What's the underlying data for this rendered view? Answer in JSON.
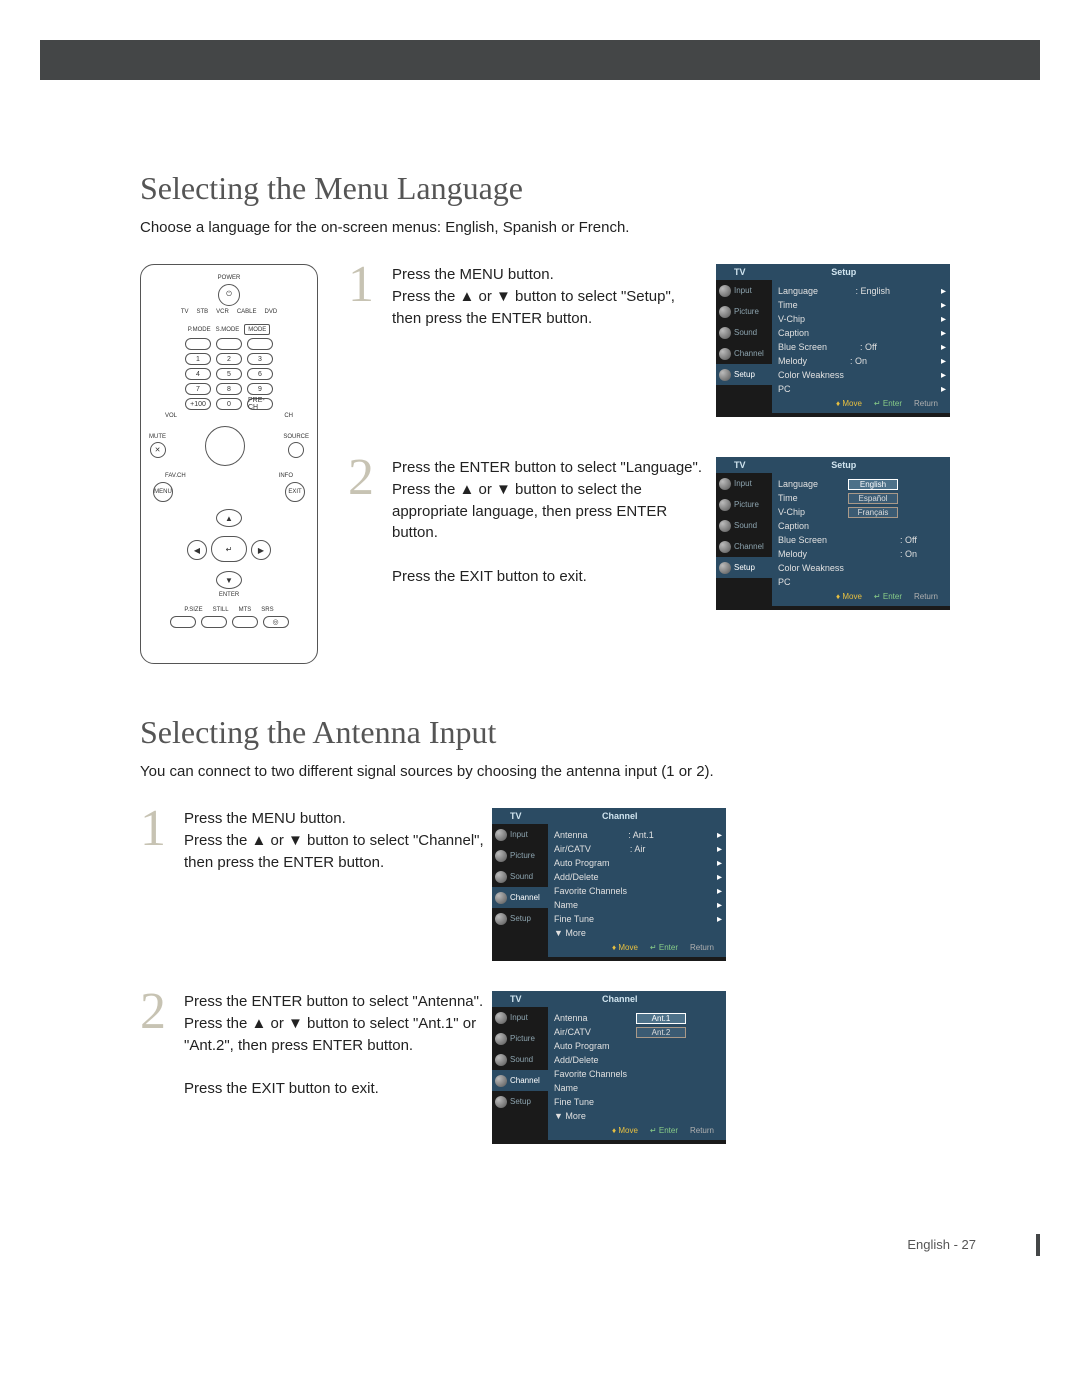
{
  "heading1": "Selecting the Menu Language",
  "intro1": "Choose a language for the on-screen menus: English, Spanish or French.",
  "heading2": "Selecting the Antenna Input",
  "intro2": "You can connect to two different signal sources by choosing the antenna input (1 or 2).",
  "remote": {
    "power": "POWER",
    "modes": [
      "TV",
      "STB",
      "VCR",
      "CABLE",
      "DVD"
    ],
    "pmode": "P.MODE",
    "smode": "S.MODE",
    "mode": "MODE",
    "nums": [
      "1",
      "2",
      "3",
      "4",
      "5",
      "6",
      "7",
      "8",
      "9",
      "0"
    ],
    "plus100": "+100",
    "prech": "PRE-CH",
    "vol": "VOL",
    "ch": "CH",
    "mute": "MUTE",
    "source": "SOURCE",
    "fav": "FAV.CH",
    "info": "INFO",
    "menu": "MENU",
    "exit": "EXIT",
    "enter": "ENTER",
    "psize": "P.SIZE",
    "still": "STILL",
    "mts": "MTS",
    "srs": "SRS"
  },
  "step1a": {
    "num": "1",
    "l1": "Press the MENU button.",
    "l2": "Press the ▲ or ▼ button to select \"Setup\", then press the ENTER button."
  },
  "step1b": {
    "num": "2",
    "l1": "Press the ENTER button to select \"Language\".",
    "l2": "Press the ▲ or ▼ button to select the appropriate language, then press ENTER button.",
    "l3": "Press the EXIT button to exit."
  },
  "step2a": {
    "num": "1",
    "l1": "Press the MENU button.",
    "l2": "Press the ▲ or ▼ button to select \"Channel\", then press the ENTER button."
  },
  "step2b": {
    "num": "2",
    "l1": "Press the ENTER button to select \"Antenna\".",
    "l2": "Press the ▲ or ▼ button to select \"Ant.1\" or \"Ant.2\", then press ENTER button.",
    "l3": "Press the EXIT button to exit."
  },
  "osd": {
    "tv": "TV",
    "tabs": [
      "Input",
      "Picture",
      "Sound",
      "Channel",
      "Setup"
    ],
    "setup_title": "Setup",
    "channel_title": "Channel",
    "setup_items": [
      {
        "k": "Language",
        "v": ": English"
      },
      {
        "k": "Time",
        "v": ""
      },
      {
        "k": "V-Chip",
        "v": ""
      },
      {
        "k": "Caption",
        "v": ""
      },
      {
        "k": "Blue Screen",
        "v": ": Off"
      },
      {
        "k": "Melody",
        "v": ": On"
      },
      {
        "k": "Color Weakness",
        "v": ""
      },
      {
        "k": "PC",
        "v": ""
      }
    ],
    "lang_opts": [
      "English",
      "Español",
      "Français"
    ],
    "channel_items": [
      {
        "k": "Antenna",
        "v": ": Ant.1"
      },
      {
        "k": "Air/CATV",
        "v": ": Air"
      },
      {
        "k": "Auto Program",
        "v": ""
      },
      {
        "k": "Add/Delete",
        "v": ""
      },
      {
        "k": "Favorite Channels",
        "v": ""
      },
      {
        "k": "Name",
        "v": ""
      },
      {
        "k": "Fine Tune",
        "v": ""
      },
      {
        "k": "▼ More",
        "v": ""
      }
    ],
    "ant_opts": [
      "Ant.1",
      "Ant.2"
    ],
    "foot_move": "Move",
    "foot_enter": "Enter",
    "foot_return": "Return"
  },
  "pagenum": "English - 27"
}
